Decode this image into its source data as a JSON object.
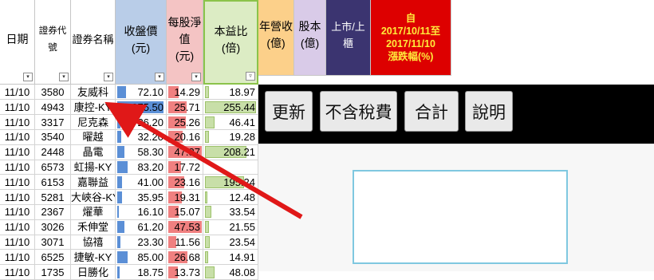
{
  "headers": {
    "date": "日期",
    "code": "證券代號",
    "name": "證券名稱",
    "price": "收盤價\n(元)",
    "nav": "每股淨\n值\n(元)",
    "pe": "本益比\n(倍)",
    "revenue": "年營收\n(億)",
    "capital": "股本\n(億)",
    "listing": "上市/上櫃",
    "change": "自\n2017/10/11至\n2017/11/10\n漲跌幅(%)"
  },
  "rows": [
    {
      "date": "11/10",
      "code": "3580",
      "name": "友威科",
      "price": "72.10",
      "nav": "14.29",
      "pe": "18.97",
      "price_v": 72.1,
      "nav_v": 14.29,
      "pe_v": 18.97
    },
    {
      "date": "11/10",
      "code": "4943",
      "name": "康控-KY",
      "price": "375.50",
      "nav": "25.71",
      "pe": "255.44",
      "price_v": 375.5,
      "nav_v": 25.71,
      "pe_v": 255.44
    },
    {
      "date": "11/10",
      "code": "3317",
      "name": "尼克森",
      "price": "26.20",
      "nav": "25.26",
      "pe": "46.41",
      "price_v": 26.2,
      "nav_v": 25.26,
      "pe_v": 46.41
    },
    {
      "date": "11/10",
      "code": "3540",
      "name": "曜越",
      "price": "32.20",
      "nav": "20.16",
      "pe": "19.28",
      "price_v": 32.2,
      "nav_v": 20.16,
      "pe_v": 19.28
    },
    {
      "date": "11/10",
      "code": "2448",
      "name": "晶電",
      "price": "58.30",
      "nav": "47.37",
      "pe": "208.21",
      "price_v": 58.3,
      "nav_v": 47.37,
      "pe_v": 208.21
    },
    {
      "date": "11/10",
      "code": "6573",
      "name": "虹揚-KY",
      "price": "83.20",
      "nav": "17.72",
      "pe": "",
      "price_v": 83.2,
      "nav_v": 17.72,
      "pe_v": 0
    },
    {
      "date": "11/10",
      "code": "6153",
      "name": "嘉聯益",
      "price": "41.00",
      "nav": "23.16",
      "pe": "195.24",
      "price_v": 41.0,
      "nav_v": 23.16,
      "pe_v": 195.24
    },
    {
      "date": "11/10",
      "code": "5281",
      "name": "大峽谷-KY",
      "price": "35.95",
      "nav": "19.31",
      "pe": "12.48",
      "price_v": 35.95,
      "nav_v": 19.31,
      "pe_v": 12.48
    },
    {
      "date": "11/10",
      "code": "2367",
      "name": "燿華",
      "price": "16.10",
      "nav": "15.07",
      "pe": "33.54",
      "price_v": 16.1,
      "nav_v": 15.07,
      "pe_v": 33.54
    },
    {
      "date": "11/10",
      "code": "3026",
      "name": "禾伸堂",
      "price": "61.20",
      "nav": "47.53",
      "pe": "21.55",
      "price_v": 61.2,
      "nav_v": 47.53,
      "pe_v": 21.55
    },
    {
      "date": "11/10",
      "code": "3071",
      "name": "協禧",
      "price": "23.30",
      "nav": "11.56",
      "pe": "23.54",
      "price_v": 23.3,
      "nav_v": 11.56,
      "pe_v": 23.54
    },
    {
      "date": "11/10",
      "code": "6525",
      "name": "捷敏-KY",
      "price": "85.00",
      "nav": "26.68",
      "pe": "14.91",
      "price_v": 85.0,
      "nav_v": 26.68,
      "pe_v": 14.91
    },
    {
      "date": "11/10",
      "code": "1735",
      "name": "日勝化",
      "price": "18.75",
      "nav": "13.73",
      "pe": "48.08",
      "price_v": 18.75,
      "nav_v": 13.73,
      "pe_v": 48.08
    }
  ],
  "buttons": {
    "refresh": "更新",
    "no_tax": "不含稅費",
    "total": "合計",
    "help": "說明"
  },
  "colors": {
    "price_bar": "#5b8fd6",
    "nav_bar": "#f08080",
    "pe_bar": "#c8dfa8",
    "header_blue": "#b9cde8",
    "header_pink": "#f4c4c4",
    "header_green": "#dcecc4",
    "header_orange": "#fcd08a",
    "header_purple": "#d9cbe8",
    "header_navy": "#3b3470",
    "header_red": "#dd0000",
    "arrow": "#e01818"
  }
}
